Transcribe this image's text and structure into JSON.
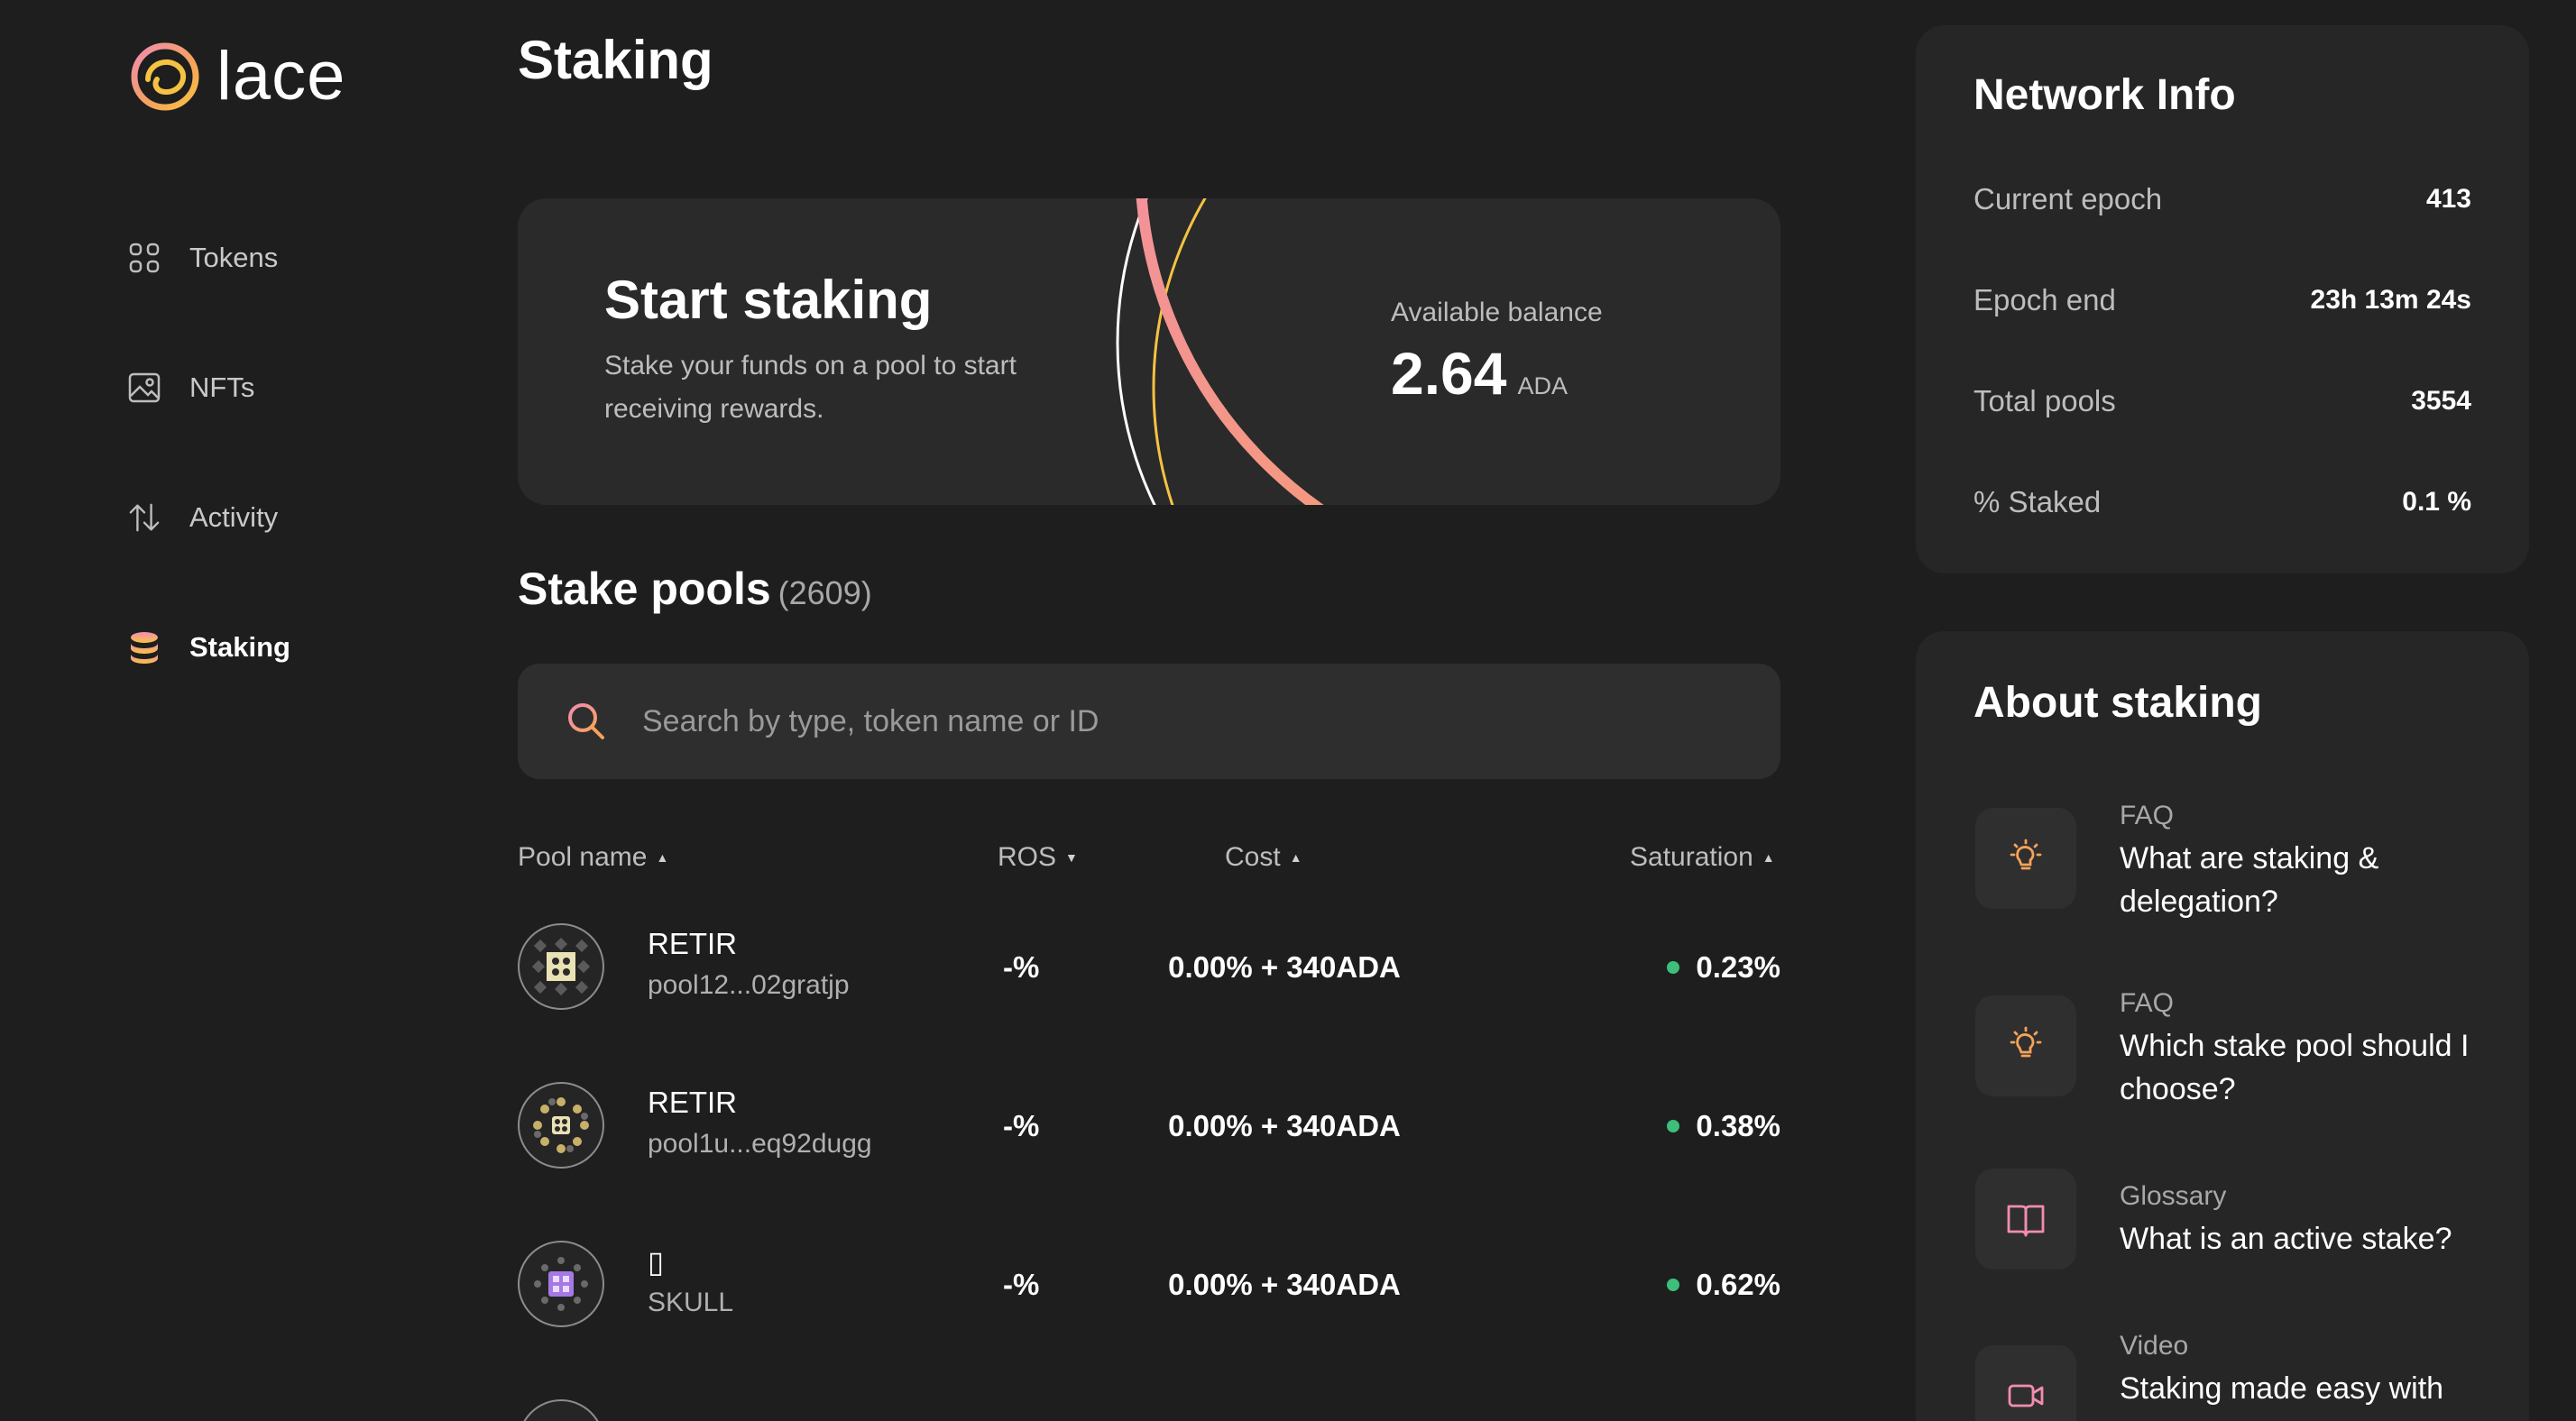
{
  "app": {
    "logo_text": "lace",
    "brand_colors": {
      "pink": "#f28cb0",
      "orange": "#f5a35a",
      "yellow": "#f6c243",
      "green": "#3dbe7a"
    }
  },
  "sidebar": {
    "items": [
      {
        "label": "Tokens",
        "icon": "grid-icon",
        "active": false
      },
      {
        "label": "NFTs",
        "icon": "image-icon",
        "active": false
      },
      {
        "label": "Activity",
        "icon": "arrows-updown-icon",
        "active": false
      },
      {
        "label": "Staking",
        "icon": "coins-stack-icon",
        "active": true
      }
    ]
  },
  "main": {
    "title": "Staking",
    "hero": {
      "title": "Start staking",
      "description": "Stake your funds on a pool to start receiving rewards.",
      "balance_label": "Available balance",
      "balance_value": "2.64",
      "balance_unit": "ADA"
    },
    "pools": {
      "title": "Stake pools",
      "count": "(2609)",
      "search_placeholder": "Search by type, token name or ID",
      "columns": {
        "name": "Pool name",
        "ros": "ROS",
        "cost": "Cost",
        "saturation": "Saturation"
      },
      "rows": [
        {
          "name": "RETIR",
          "id": "pool12...02gratjp",
          "ros": "-%",
          "cost": "0.00% + 340ADA",
          "saturation": "0.23%",
          "avatar_color": "#e8e2b4"
        },
        {
          "name": "RETIR",
          "id": "pool1u...eq92dugg",
          "ros": "-%",
          "cost": "0.00% + 340ADA",
          "saturation": "0.38%",
          "avatar_color": "#c9b06a"
        },
        {
          "name": "▯",
          "id": "SKULL",
          "ros": "-%",
          "cost": "0.00% + 340ADA",
          "saturation": "0.62%",
          "avatar_color": "#a678e6"
        }
      ]
    }
  },
  "network_info": {
    "title": "Network Info",
    "rows": [
      {
        "label": "Current epoch",
        "value": "413"
      },
      {
        "label": "Epoch end",
        "value": "23h 13m 24s"
      },
      {
        "label": "Total pools",
        "value": "3554"
      },
      {
        "label": "% Staked",
        "value": "0.1 %"
      }
    ]
  },
  "about": {
    "title": "About staking",
    "items": [
      {
        "kind": "FAQ",
        "question": "What are staking & delegation?",
        "icon": "lightbulb-icon"
      },
      {
        "kind": "FAQ",
        "question": "Which stake pool should I choose?",
        "icon": "lightbulb-icon"
      },
      {
        "kind": "Glossary",
        "question": "What is an active stake?",
        "icon": "book-icon"
      },
      {
        "kind": "Video",
        "question": "Staking made easy with",
        "icon": "video-icon"
      }
    ]
  }
}
